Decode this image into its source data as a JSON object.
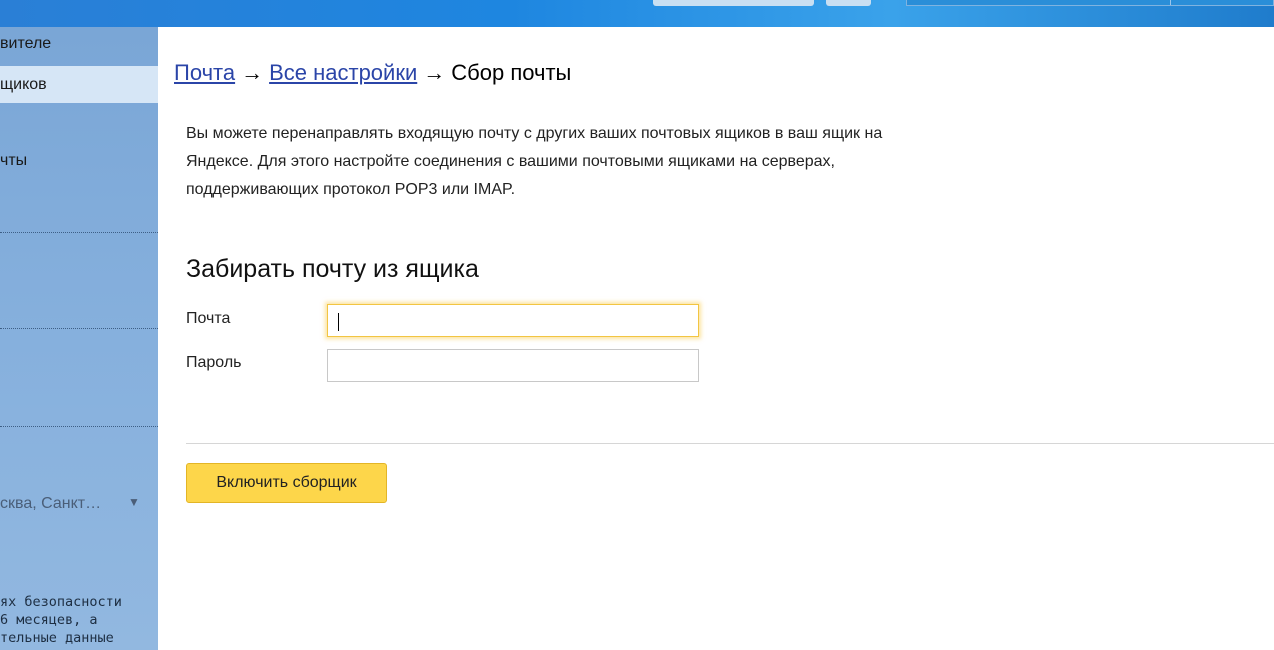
{
  "sidebar": {
    "items": [
      {
        "label": "вителе"
      },
      {
        "label": "щиков",
        "active": true
      },
      {
        "label": "чты"
      }
    ],
    "region_select": "сква, Санкт…",
    "note_lines": [
      "ях безопасности",
      "6 месяцев, а",
      "тельные данные"
    ]
  },
  "breadcrumb": {
    "link1": "Почта",
    "link2": "Все настройки",
    "current": "Сбор почты",
    "separator": "→"
  },
  "intro_text": "Вы можете перенаправлять входящую почту с других ваших почтовых ящиков в ваш ящик на Яндексе. Для этого настройте соединения с вашими почтовыми ящиками на серверах, поддерживающих протокол POP3 или IMAP.",
  "form": {
    "title": "Забирать почту из ящика",
    "email_label": "Почта",
    "email_value": "",
    "password_label": "Пароль",
    "password_value": "",
    "submit_label": "Включить сборщик"
  },
  "colors": {
    "header": "#1e86e0",
    "sidebar": "#86b0dd",
    "link": "#2b45a8",
    "button": "#fdd64a"
  }
}
